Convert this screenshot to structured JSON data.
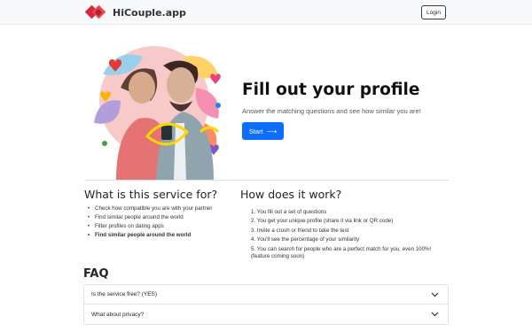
{
  "navbar": {
    "brand_name": "HiCouple.app",
    "login_label": "Login"
  },
  "hero": {
    "title": "Fill out your profile",
    "subtitle": "Answer the matching questions and see how similar you are!",
    "start_label": "Start",
    "start_icon": "arrow-right-icon"
  },
  "service": {
    "heading": "What is this service for?",
    "items": [
      "Check how compatible you are with your partner",
      "Find similar people around the world",
      "Filter profiles on dating apps",
      "Find similar people around the world"
    ]
  },
  "how": {
    "heading": "How does it work?",
    "steps": [
      "1. You fill out a set of questions",
      "2. You get your unique profile (share it via link or QR code)",
      "3. Invite a crush or friend to take the test",
      "4. You'll see the percentage of your similarity",
      "5. You can search for people who are a perfect match for you, even 100%! (feature coming soon)"
    ]
  },
  "faq": {
    "heading": "FAQ",
    "items": [
      "Is the service free? (YES)",
      "What about privacy?"
    ]
  },
  "colors": {
    "brand_red": "#e03a3e",
    "primary_blue": "#0d6efd"
  }
}
